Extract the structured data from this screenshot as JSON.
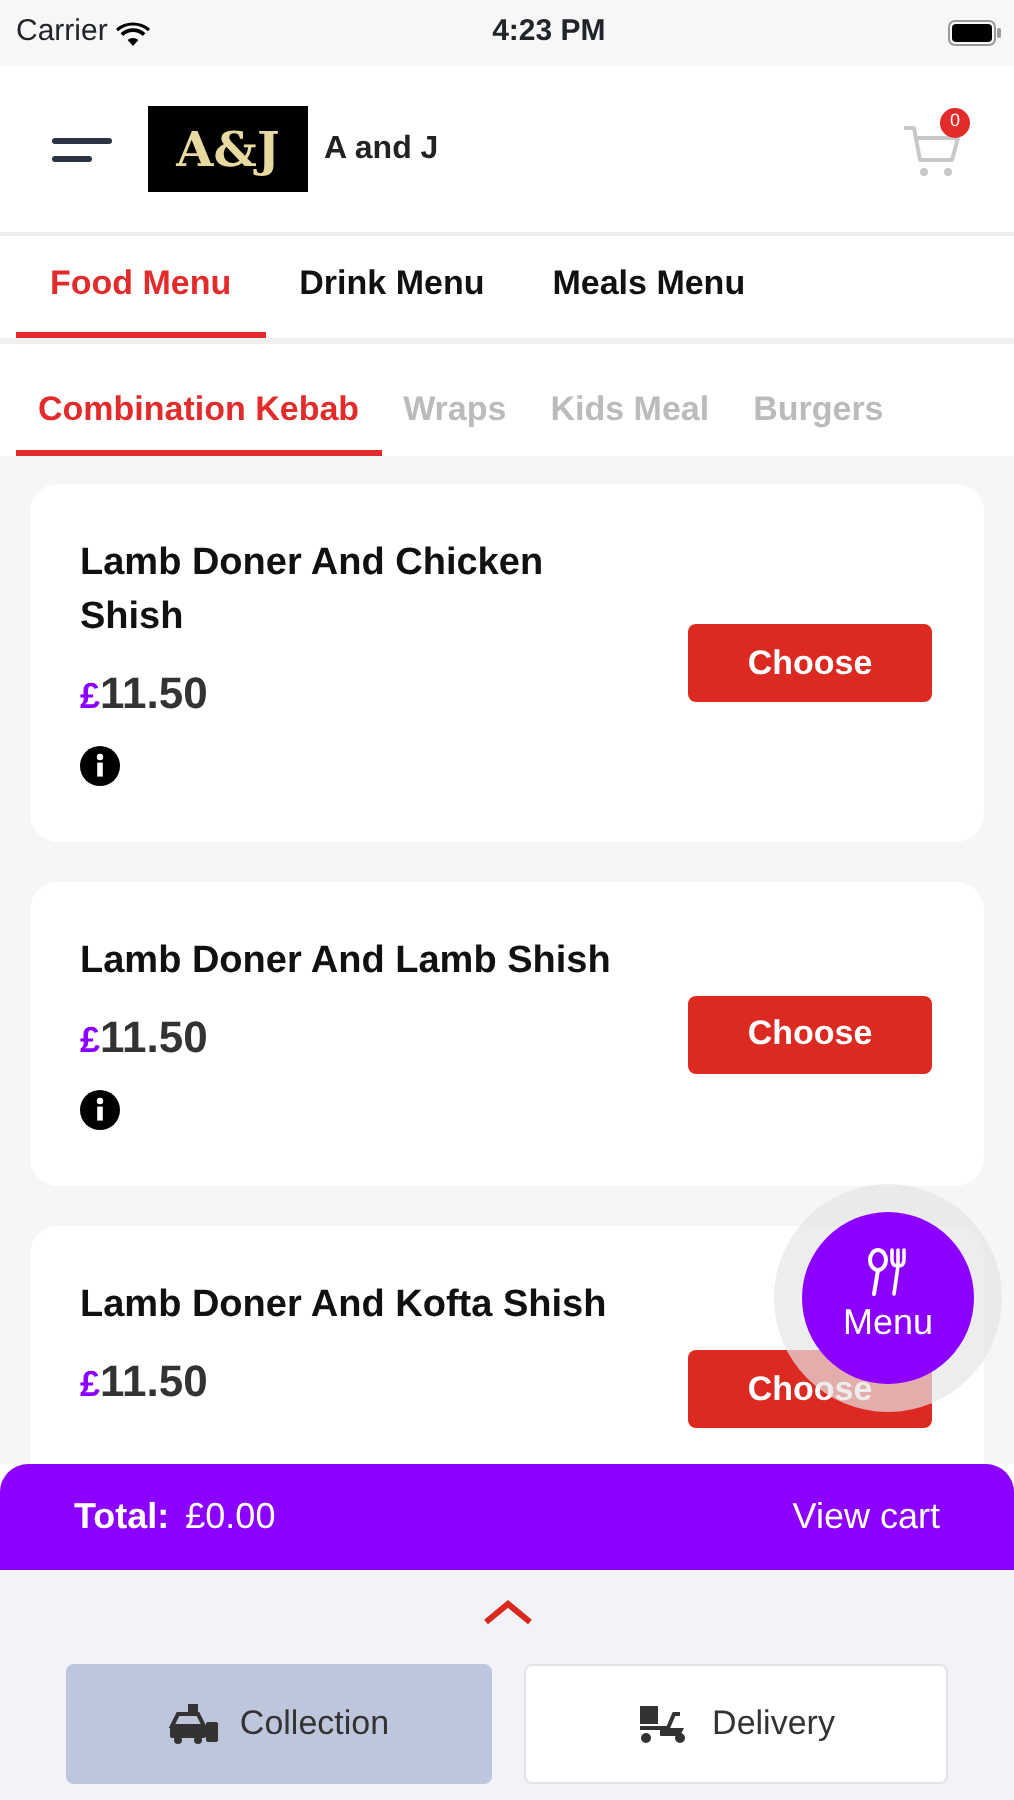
{
  "status_bar": {
    "carrier": "Carrier",
    "time": "4:23 PM"
  },
  "header": {
    "logo": "A&J",
    "shop_name": "A and J",
    "cart_count": "0"
  },
  "tabs": [
    {
      "label": "Food Menu",
      "selected": true
    },
    {
      "label": "Drink Menu",
      "selected": false
    },
    {
      "label": "Meals Menu",
      "selected": false
    }
  ],
  "categories": [
    {
      "label": "Combination Kebab",
      "selected": true
    },
    {
      "label": "Wraps",
      "selected": false
    },
    {
      "label": "Kids Meal",
      "selected": false
    },
    {
      "label": "Burgers",
      "selected": false
    }
  ],
  "items": [
    {
      "name": "Lamb Doner And Chicken Shish",
      "currency": "£",
      "price": "11.50",
      "button": "Choose",
      "info": true
    },
    {
      "name": "Lamb Doner And Lamb Shish",
      "currency": "£",
      "price": "11.50",
      "button": "Choose",
      "info": true
    },
    {
      "name": "Lamb Doner And Kofta Shish",
      "currency": "£",
      "price": "11.50",
      "button": "Choose",
      "info": false
    }
  ],
  "menu_button": "Menu",
  "total_bar": {
    "label": "Total:",
    "amount": "£0.00",
    "link": "View cart"
  },
  "order_types": [
    {
      "label": "Collection",
      "kind": "collection",
      "selected": true
    },
    {
      "label": "Delivery",
      "kind": "delivery",
      "selected": false
    }
  ]
}
